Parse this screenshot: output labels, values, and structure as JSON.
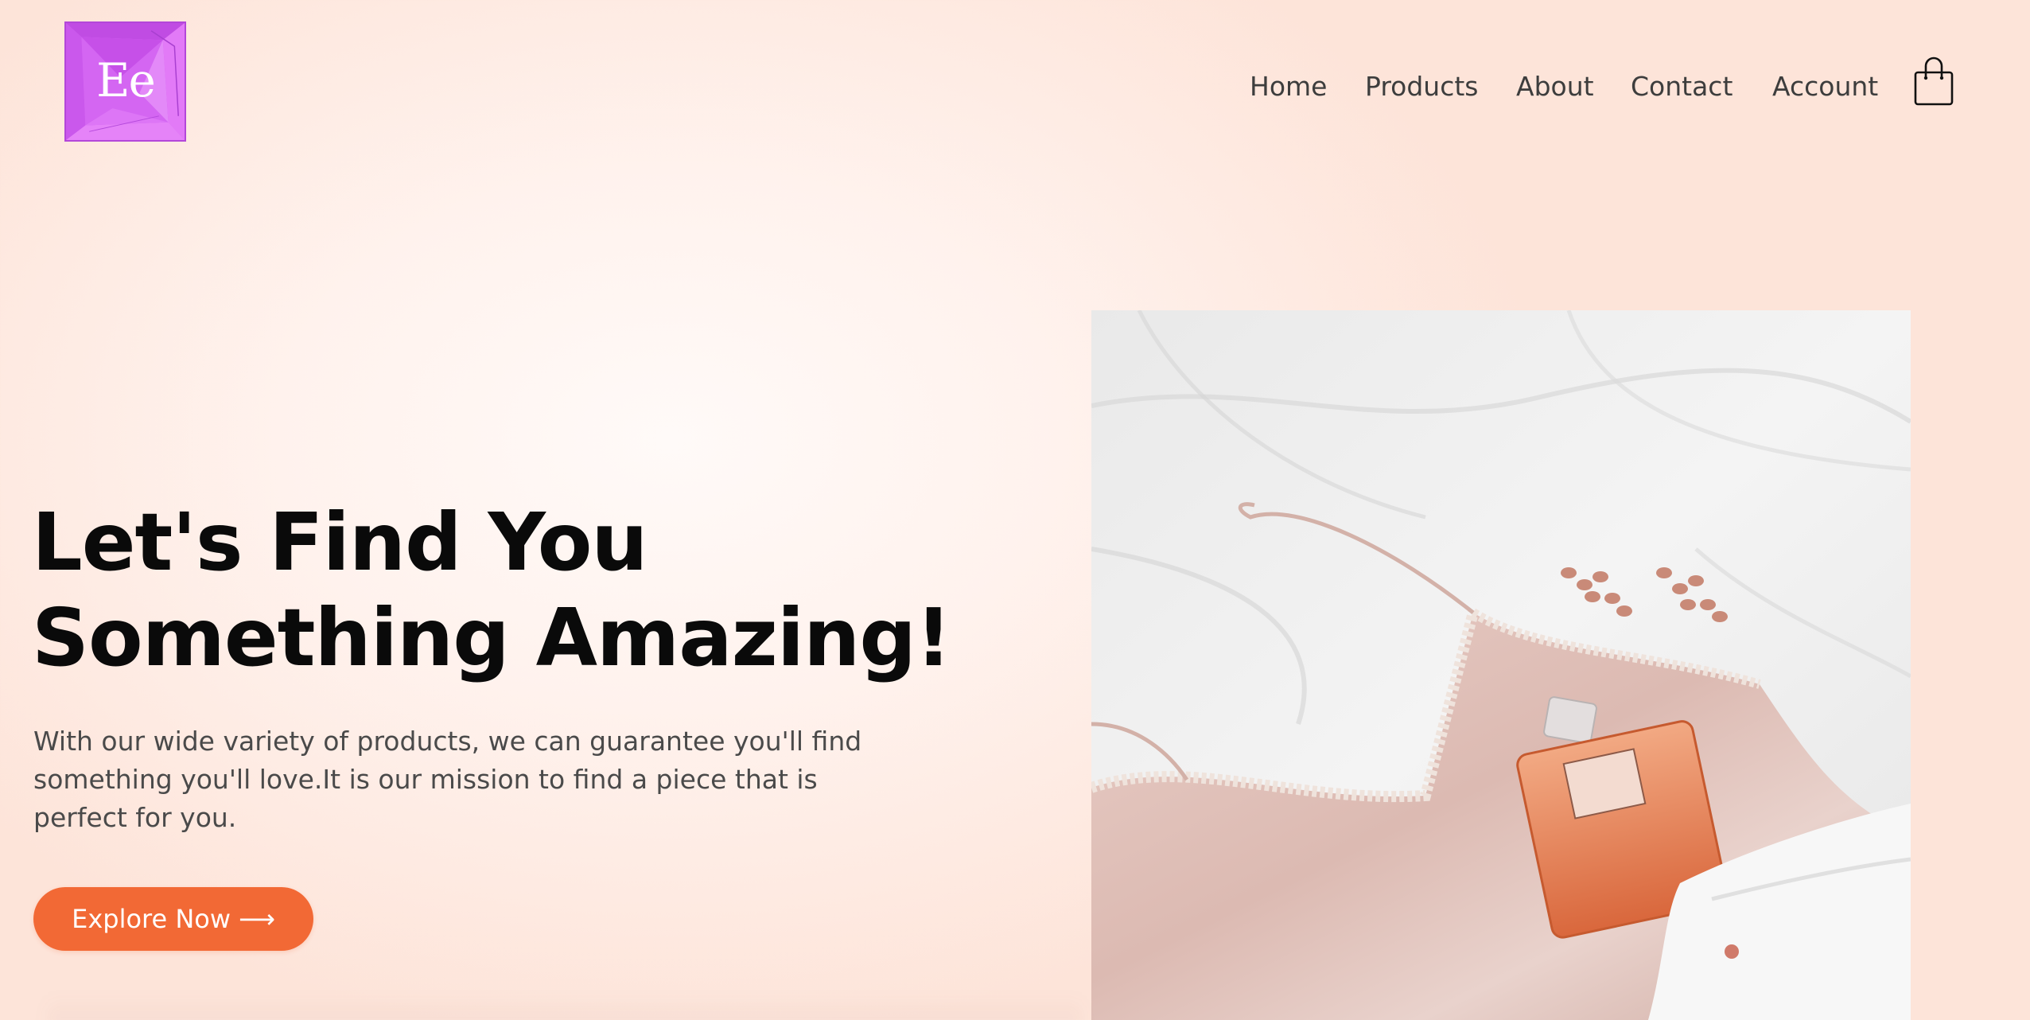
{
  "header": {
    "logo_text": "Ee",
    "nav": [
      {
        "label": "Home"
      },
      {
        "label": "Products"
      },
      {
        "label": "About"
      },
      {
        "label": "Contact"
      },
      {
        "label": "Account"
      }
    ],
    "cart_icon": "shopping-bag-icon"
  },
  "hero": {
    "headline_line1": "Let's Find You",
    "headline_line2": "Something Amazing!",
    "subtext_line1": "With our wide variety of products, we can guarantee you'll find",
    "subtext_line2": "something you'll love.It is our mission to find a piece that is",
    "subtext_line3": "perfect for you.",
    "cta_label": "Explore Now",
    "cta_icon": "arrow-right-icon",
    "image_description": "product-photo"
  },
  "colors": {
    "accent": "#f26935",
    "logo": "#d563f2",
    "background": "#fde4d9"
  }
}
